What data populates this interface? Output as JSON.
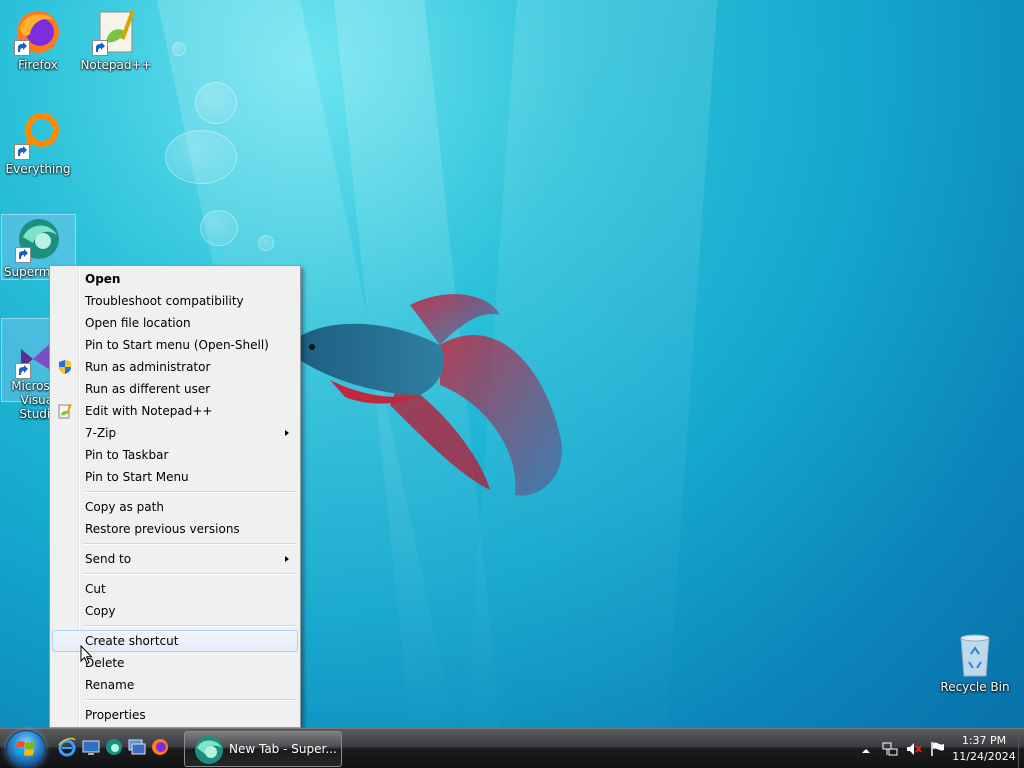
{
  "desktop": {
    "icons": [
      {
        "label": "Firefox",
        "icon": "firefox-icon"
      },
      {
        "label": "Notepad++",
        "icon": "notepadpp-icon"
      },
      {
        "label": "Everything",
        "icon": "everything-icon"
      },
      {
        "label": "Supermium",
        "icon": "supermium-icon"
      },
      {
        "label": "Microsoft Visual Studio",
        "icon": "visual-studio-icon"
      },
      {
        "label": "Recycle Bin",
        "icon": "recycle-bin-icon"
      }
    ]
  },
  "context_menu": {
    "items": [
      {
        "label": "Open",
        "bold": true
      },
      {
        "label": "Troubleshoot compatibility"
      },
      {
        "label": "Open file location"
      },
      {
        "label": "Pin to Start menu (Open-Shell)"
      },
      {
        "label": "Run as administrator",
        "icon": "uac-shield-icon"
      },
      {
        "label": "Run as different user"
      },
      {
        "label": "Edit with Notepad++",
        "icon": "notepadpp-icon"
      },
      {
        "label": "7-Zip",
        "submenu": true
      },
      {
        "label": "Pin to Taskbar"
      },
      {
        "label": "Pin to Start Menu"
      },
      {
        "label": "Copy as path"
      },
      {
        "label": "Restore previous versions"
      },
      {
        "label": "Send to",
        "submenu": true
      },
      {
        "label": "Cut"
      },
      {
        "label": "Copy"
      },
      {
        "label": "Create shortcut",
        "highlighted": true
      },
      {
        "label": "Delete"
      },
      {
        "label": "Rename"
      },
      {
        "label": "Properties"
      }
    ]
  },
  "taskbar": {
    "start": {
      "icon": "windows-logo-icon"
    },
    "quick_launch": [
      "ie-icon",
      "show-desktop-icon",
      "supermium-icon",
      "switch-windows-icon",
      "firefox-icon"
    ],
    "tasks": [
      {
        "label": "New Tab - Super...",
        "icon": "supermium-icon",
        "active": true
      }
    ],
    "tray_icons": [
      "show-hidden-icons",
      "network-icon",
      "volume-muted-icon",
      "action-center-flag-icon"
    ],
    "clock": {
      "time": "1:37 PM",
      "date": "11/24/2024"
    }
  },
  "colors": {
    "desktop_top": "#6fe5f0",
    "desktop_bottom": "#0a6fa8",
    "menu_bg": "#f0f0f0",
    "menu_highlight_border": "#aecff7",
    "taskbar": "#1c1d1f"
  }
}
